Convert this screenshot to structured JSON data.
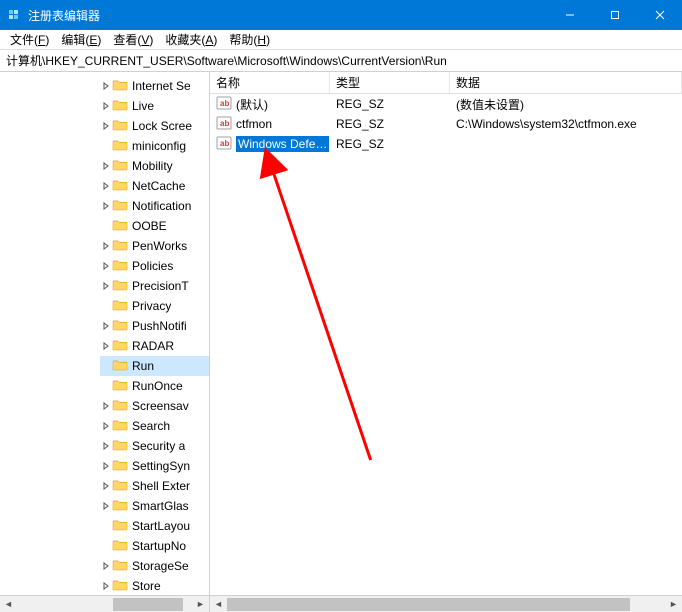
{
  "titlebar": {
    "title": "注册表编辑器"
  },
  "menubar": {
    "items": [
      {
        "label": "文件(F)"
      },
      {
        "label": "编辑(E)"
      },
      {
        "label": "查看(V)"
      },
      {
        "label": "收藏夹(A)"
      },
      {
        "label": "帮助(H)"
      }
    ]
  },
  "address": "计算机\\HKEY_CURRENT_USER\\Software\\Microsoft\\Windows\\CurrentVersion\\Run",
  "tree": {
    "nodes": [
      {
        "label": "Internet Se",
        "expandable": true
      },
      {
        "label": "Live",
        "expandable": true
      },
      {
        "label": "Lock Scree",
        "expandable": true
      },
      {
        "label": "miniconfig",
        "expandable": false
      },
      {
        "label": "Mobility",
        "expandable": true
      },
      {
        "label": "NetCache",
        "expandable": true
      },
      {
        "label": "Notification",
        "expandable": true
      },
      {
        "label": "OOBE",
        "expandable": false
      },
      {
        "label": "PenWorks",
        "expandable": true
      },
      {
        "label": "Policies",
        "expandable": true
      },
      {
        "label": "PrecisionT",
        "expandable": true
      },
      {
        "label": "Privacy",
        "expandable": false
      },
      {
        "label": "PushNotifi",
        "expandable": true
      },
      {
        "label": "RADAR",
        "expandable": true
      },
      {
        "label": "Run",
        "expandable": false,
        "selected": true
      },
      {
        "label": "RunOnce",
        "expandable": false
      },
      {
        "label": "Screensav",
        "expandable": true
      },
      {
        "label": "Search",
        "expandable": true
      },
      {
        "label": "Security a",
        "expandable": true
      },
      {
        "label": "SettingSyn",
        "expandable": true
      },
      {
        "label": "Shell Exter",
        "expandable": true
      },
      {
        "label": "SmartGlas",
        "expandable": true
      },
      {
        "label": "StartLayou",
        "expandable": false
      },
      {
        "label": "StartupNo",
        "expandable": false
      },
      {
        "label": "StorageSe",
        "expandable": true
      },
      {
        "label": "Store",
        "expandable": true
      }
    ]
  },
  "list": {
    "headers": {
      "name": "名称",
      "type": "类型",
      "data": "数据"
    },
    "rows": [
      {
        "name": "(默认)",
        "type": "REG_SZ",
        "data": "(数值未设置)",
        "selected": false
      },
      {
        "name": "ctfmon",
        "type": "REG_SZ",
        "data": "C:\\Windows\\system32\\ctfmon.exe",
        "selected": false
      },
      {
        "name": "Windows Defe…",
        "type": "REG_SZ",
        "data": "",
        "selected": true
      }
    ]
  },
  "colors": {
    "accent": "#0078d7",
    "selection": "#cce8ff",
    "selection_dark": "#0078d7"
  }
}
